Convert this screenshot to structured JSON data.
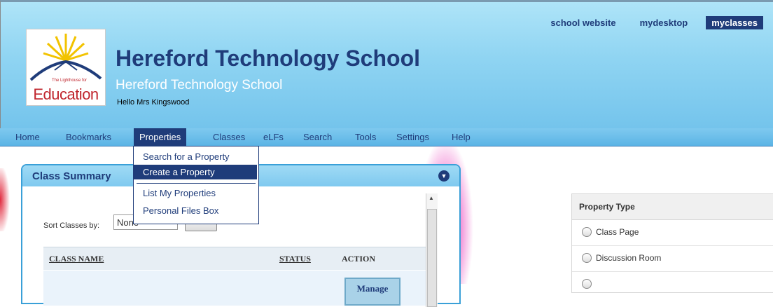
{
  "header": {
    "links": [
      "school website",
      "mydesktop",
      "myclasses"
    ],
    "active_link": "myclasses",
    "logo_text": "Education",
    "logo_tagline": "The Lighthouse for",
    "title": "Hereford Technology School",
    "subtitle": "Hereford Technology School",
    "greeting": "Hello Mrs Kingswood"
  },
  "nav": {
    "items": [
      "Home",
      "Bookmarks",
      "Properties",
      "Classes",
      "eLFs",
      "Search",
      "Tools",
      "Settings",
      "Help"
    ],
    "active": "Properties"
  },
  "dropdown": {
    "items": [
      "Search for a Property",
      "Create a Property",
      "List My Properties",
      "Personal Files Box"
    ],
    "highlighted": "Create a Property"
  },
  "class_summary": {
    "title": "Class Summary",
    "sort_label": "Sort Classes by:",
    "sort_value": "None",
    "columns": [
      "CLASS NAME",
      "STATUS",
      "ACTION"
    ],
    "row_action": "Manage"
  },
  "property_type": {
    "title": "Property Type",
    "options": [
      "Class Page",
      "Discussion Room"
    ]
  },
  "colors": {
    "navy": "#1f3c7a",
    "sky": "#8fd4f2",
    "panel_border": "#3aa0d8"
  }
}
